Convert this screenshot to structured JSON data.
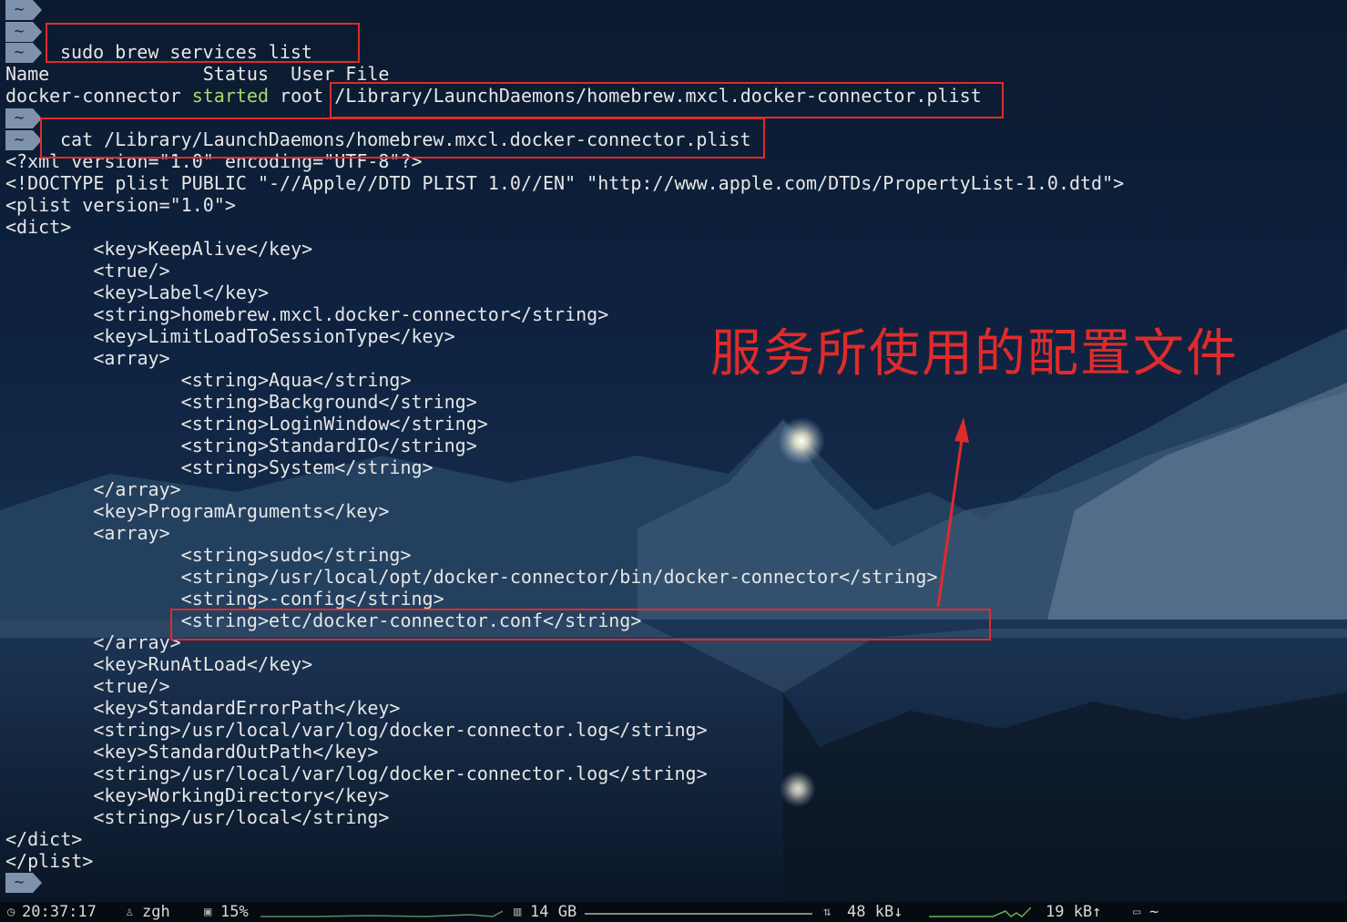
{
  "terminal": {
    "prompt_symbol": "~",
    "command1": "sudo brew services list",
    "header": "Name              Status  User File",
    "service_row": {
      "name": "docker-connector ",
      "status": "started",
      "rest": " root /Library/LaunchDaemons/homebrew.mxcl.docker-connector.plist"
    },
    "command2": "cat /Library/LaunchDaemons/homebrew.mxcl.docker-connector.plist",
    "output": [
      "<?xml version=\"1.0\" encoding=\"UTF-8\"?>",
      "<!DOCTYPE plist PUBLIC \"-//Apple//DTD PLIST 1.0//EN\" \"http://www.apple.com/DTDs/PropertyList-1.0.dtd\">",
      "<plist version=\"1.0\">",
      "<dict>",
      "        <key>KeepAlive</key>",
      "        <true/>",
      "        <key>Label</key>",
      "        <string>homebrew.mxcl.docker-connector</string>",
      "        <key>LimitLoadToSessionType</key>",
      "        <array>",
      "                <string>Aqua</string>",
      "                <string>Background</string>",
      "                <string>LoginWindow</string>",
      "                <string>StandardIO</string>",
      "                <string>System</string>",
      "        </array>",
      "        <key>ProgramArguments</key>",
      "        <array>",
      "                <string>sudo</string>",
      "                <string>/usr/local/opt/docker-connector/bin/docker-connector</string>",
      "                <string>-config</string>",
      "                <string>etc/docker-connector.conf</string>",
      "        </array>",
      "        <key>RunAtLoad</key>",
      "        <true/>",
      "        <key>StandardErrorPath</key>",
      "        <string>/usr/local/var/log/docker-connector.log</string>",
      "        <key>StandardOutPath</key>",
      "        <string>/usr/local/var/log/docker-connector.log</string>",
      "        <key>WorkingDirectory</key>",
      "        <string>/usr/local</string>",
      "</dict>",
      "</plist>"
    ]
  },
  "annotation": {
    "text": "服务所使用的配置文件",
    "color": "#e02b2b"
  },
  "statusbar": {
    "clock": "20:37:17",
    "user": "zgh",
    "cpu": "15%",
    "memory": "14 GB",
    "net_down": "48 kB↓",
    "net_up": "19 kB↑",
    "cwd": "~",
    "icons": {
      "clock": "clock-icon",
      "user": "user-icon",
      "cpu": "cpu-icon",
      "memory": "memory-icon",
      "network": "network-icon",
      "folder": "folder-icon"
    }
  }
}
